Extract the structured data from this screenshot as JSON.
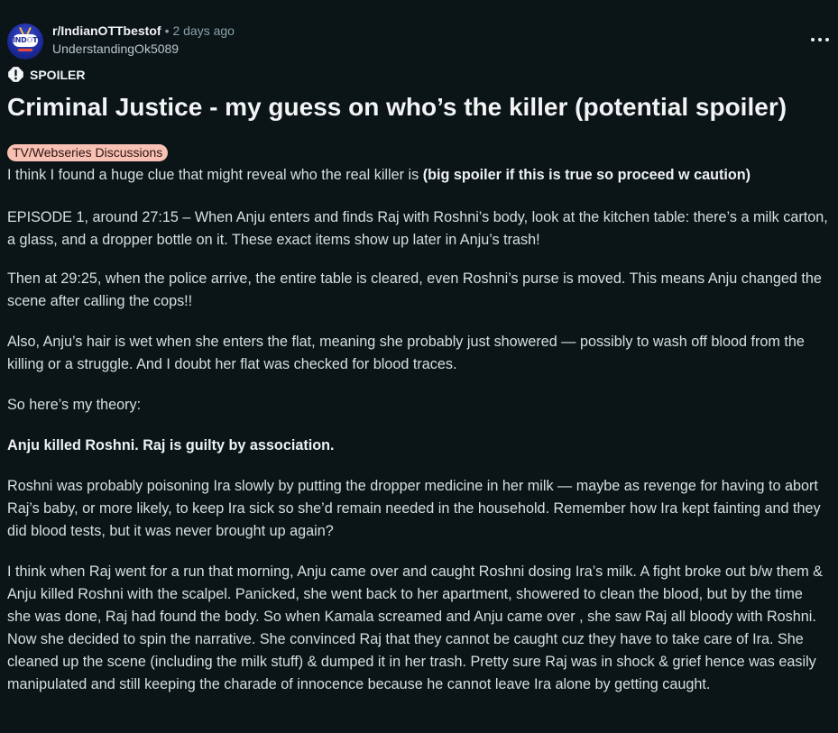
{
  "post": {
    "subreddit": "r/IndianOTTbestof",
    "separator": "•",
    "time": "2 days ago",
    "author": "UnderstandingOk5089",
    "avatar_text": "IND⚇TT",
    "spoiler_label": "SPOILER",
    "title": "Criminal Justice - my guess on who’s the killer (potential spoiler)",
    "flair": "TV/Webseries Discussions",
    "body": {
      "p1_text": "I think I found a huge clue that might reveal who the real killer is ",
      "p1_bold": "(big spoiler if this is true so proceed w caution)",
      "p2": "EPISODE 1, around 27:15 – When Anju enters and finds Raj with Roshni’s body, look at the kitchen table: there’s a milk carton, a glass, and a dropper bottle on it. These exact items show up later in Anju’s trash!",
      "p3": "Then at 29:25, when the police arrive, the entire table is cleared, even Roshni’s purse is moved. This means Anju changed the scene after calling the cops!!",
      "p4": "Also, Anju’s hair is wet when she enters the flat, meaning she probably just showered — possibly to wash off blood from the killing or a struggle. And I doubt her flat was checked for blood traces.",
      "p5": "So here’s my theory:",
      "p6": "Anju killed Roshni. Raj is guilty by association.",
      "p7": "Roshni was probably poisoning Ira slowly by putting the dropper medicine in her milk — maybe as revenge for having to abort Raj’s baby, or more likely, to keep Ira sick so she’d remain needed in the household. Remember how Ira kept fainting and they did blood tests, but it was never brought up again?",
      "p8": "I think when Raj went for a run that morning, Anju came over and caught Roshni dosing Ira’s milk. A fight broke out b/w them & Anju killed Roshni with the scalpel. Panicked, she went back to her apartment, showered to clean the blood, but by the time she was done, Raj had found the body. So when Kamala screamed and Anju came over , she saw Raj all bloody with Roshni. Now she decided to spin the narrative. She convinced Raj that they cannot be caught cuz they have to take care of Ira. She cleaned up the scene (including the milk stuff) & dumped it in her trash. Pretty sure Raj was in shock & grief hence was easily manipulated and still keeping the charade of innocence because he cannot leave Ira alone by getting caught."
    }
  },
  "icons": {
    "avatar": "subreddit-avatar-icon",
    "spoiler": "spoiler-warning-icon",
    "more": "more-options-icon"
  },
  "colors": {
    "background": "#0b1416",
    "text": "#d7dfe3",
    "meta": "#8ba2ad",
    "flair_bg": "#f9c0b4"
  }
}
